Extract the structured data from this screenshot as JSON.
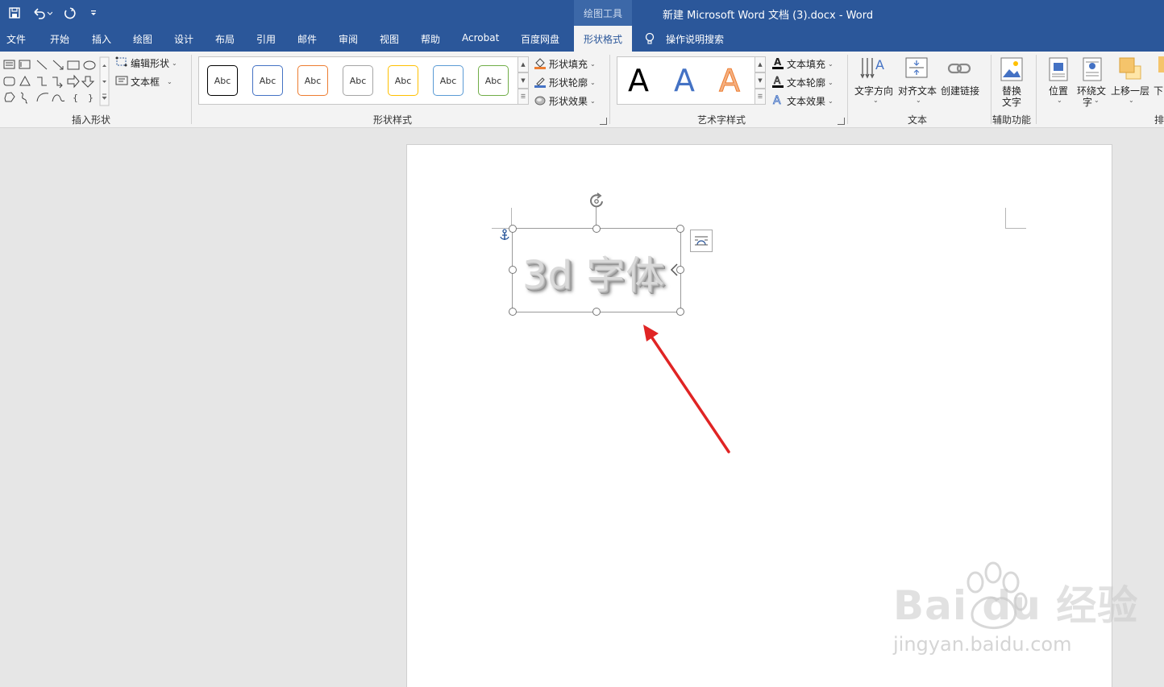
{
  "window": {
    "context_tool_label": "绘图工具",
    "document_title": "新建 Microsoft Word 文档 (3).docx  -  Word"
  },
  "quick_access": [
    "save-icon",
    "undo-icon",
    "redo-icon",
    "customize-icon"
  ],
  "tabs": [
    {
      "label": "文件"
    },
    {
      "label": "开始"
    },
    {
      "label": "插入"
    },
    {
      "label": "绘图"
    },
    {
      "label": "设计"
    },
    {
      "label": "布局"
    },
    {
      "label": "引用"
    },
    {
      "label": "邮件"
    },
    {
      "label": "审阅"
    },
    {
      "label": "视图"
    },
    {
      "label": "帮助"
    },
    {
      "label": "Acrobat"
    },
    {
      "label": "百度网盘"
    },
    {
      "label": "形状格式",
      "active": true
    }
  ],
  "search": {
    "label": "操作说明搜索"
  },
  "ribbon": {
    "insert_shapes": {
      "label": "插入形状",
      "edit_shape": "编辑形状",
      "text_box": "文本框"
    },
    "shape_styles": {
      "label": "形状样式",
      "preset_text": "Abc",
      "preset_colors": [
        "#000000",
        "#4472c4",
        "#ed7d31",
        "#a5a5a5",
        "#ffc000",
        "#5b9bd5",
        "#70ad47"
      ],
      "fill": "形状填充",
      "outline": "形状轮廓",
      "effects": "形状效果"
    },
    "wordart_styles": {
      "label": "艺术字样式",
      "sample": "A",
      "sample_colors": [
        "#000000",
        "#4472c4",
        "#f4b183"
      ],
      "text_fill": "文本填充",
      "text_outline": "文本轮廓",
      "text_effects": "文本效果"
    },
    "text": {
      "label": "文本",
      "direction": "文字方向",
      "align": "对齐文本",
      "link": "创建链接"
    },
    "accessibility": {
      "label": "辅助功能",
      "alt_text_line1": "替换",
      "alt_text_line2": "文字"
    },
    "arrange": {
      "label": "排",
      "position": "位置",
      "wrap_line1": "环绕文",
      "wrap_line2": "字",
      "bring_forward": "上移一层",
      "send_backward": "下"
    }
  },
  "document": {
    "textbox_text": "3d 字体"
  },
  "watermark": {
    "brand": "Bai du 经验",
    "url": "jingyan.baidu.com"
  },
  "colors": {
    "brand_blue": "#2b579a",
    "arrow_red": "#e02424"
  }
}
